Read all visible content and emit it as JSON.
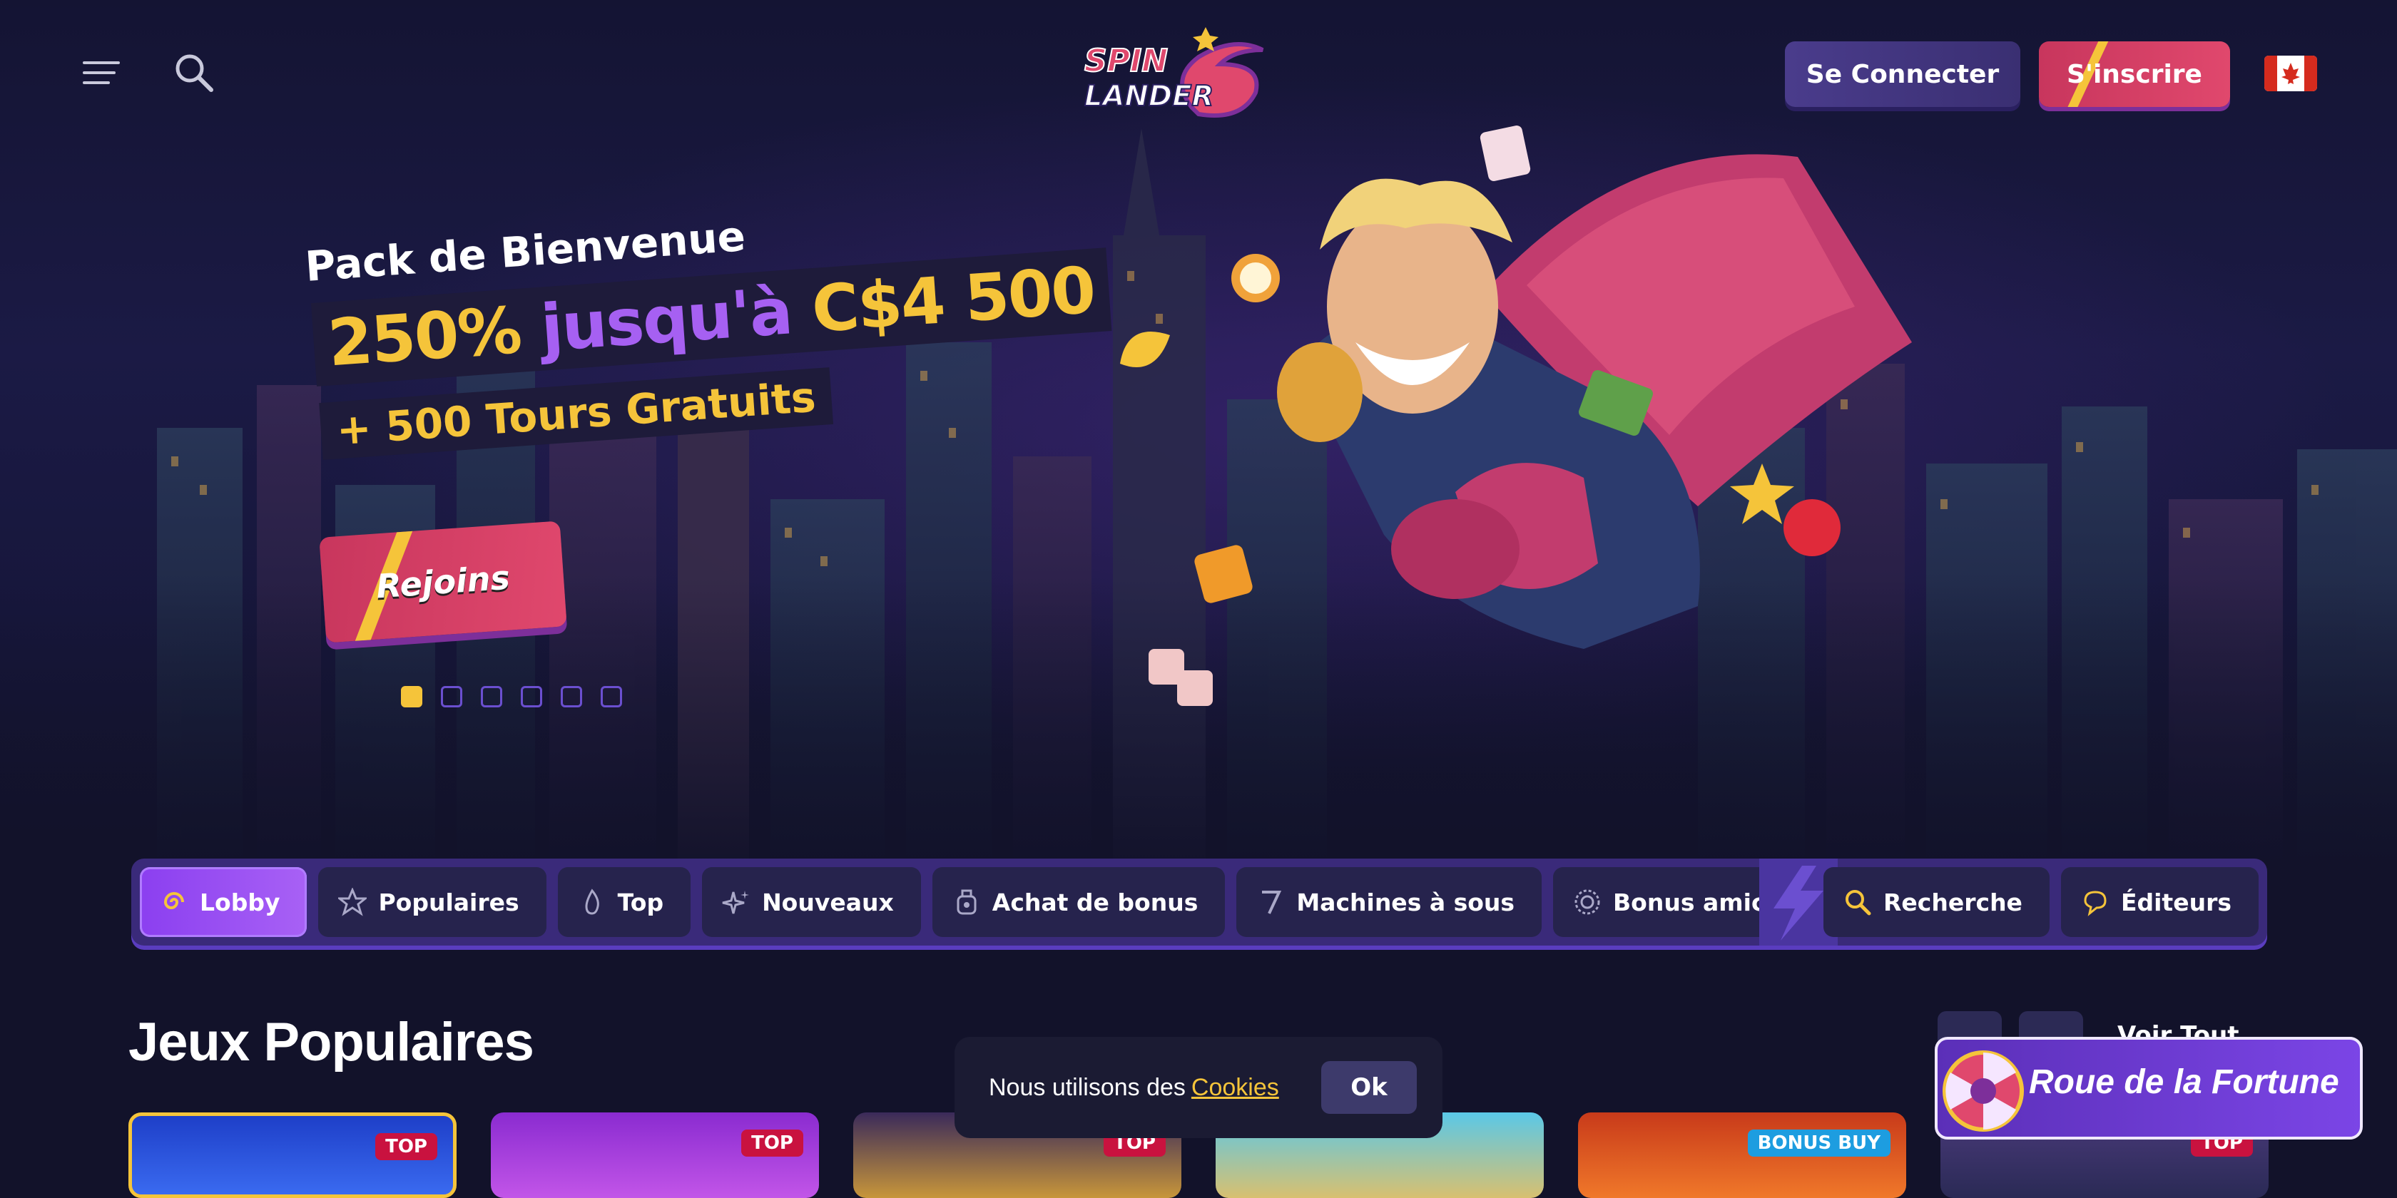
{
  "header": {
    "menu_icon": "hamburger-menu-icon",
    "search_icon": "search-icon",
    "logo_text_top": "SPIN",
    "logo_text_bottom": "LANDER",
    "login_label": "Se Connecter",
    "register_label": "S'inscrire",
    "language_flag": "canada-flag-icon"
  },
  "hero": {
    "subtitle": "Pack de Bienvenue",
    "headline_part1": "250%",
    "headline_part2": "jusqu'à",
    "headline_part3": "C$4 500",
    "extra": "+ 500 Tours Gratuits",
    "cta_label": "Rejoins",
    "slides_total": 6,
    "active_slide": 1
  },
  "nav": {
    "items": [
      {
        "label": "Lobby",
        "icon": "spiral-icon",
        "active": true
      },
      {
        "label": "Populaires",
        "icon": "star-icon",
        "active": false
      },
      {
        "label": "Top",
        "icon": "flame-icon",
        "active": false
      },
      {
        "label": "Nouveaux",
        "icon": "sparkle-icon",
        "active": false
      },
      {
        "label": "Achat de bonus",
        "icon": "money-bag-icon",
        "active": false
      },
      {
        "label": "Machines à sous",
        "icon": "seven-icon",
        "active": false
      },
      {
        "label": "Bonus amical",
        "icon": "coin-icon",
        "active": false
      }
    ],
    "next_icon": "arrow-right-icon",
    "search_label": "Recherche",
    "providers_label": "Éditeurs"
  },
  "section": {
    "title": "Jeux Populaires",
    "see_all": "Voir Tout"
  },
  "games": [
    {
      "badge": "TOP"
    },
    {
      "badge": "TOP"
    },
    {
      "badge": "TOP"
    },
    {
      "badge": ""
    },
    {
      "badge": "BONUS BUY"
    },
    {
      "badge": "TOP"
    }
  ],
  "cookie": {
    "text": "Nous utilisons des",
    "link": "Cookies",
    "ok": "Ok"
  },
  "fortune": {
    "label": "Roue de la Fortune"
  },
  "colors": {
    "accent_yellow": "#f5c43a",
    "accent_purple": "#a660f2",
    "accent_pink": "#e0486d",
    "background": "#12122a"
  }
}
